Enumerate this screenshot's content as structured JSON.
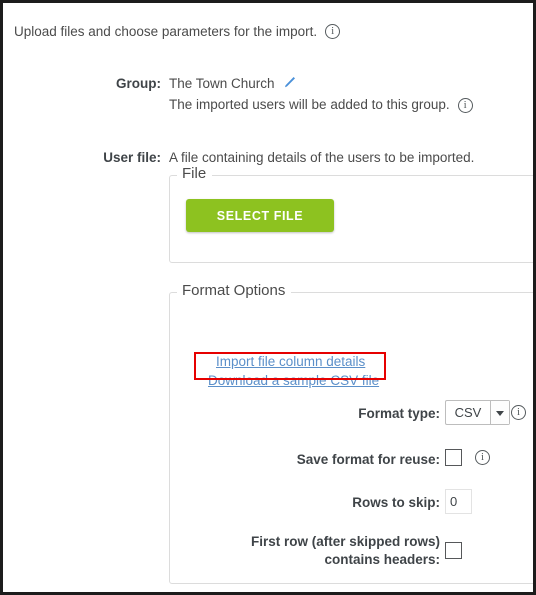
{
  "page": {
    "intro_text": "Upload files and choose parameters for the import."
  },
  "group": {
    "label": "Group:",
    "name": "The Town Church",
    "description": "The imported users will be added to this group.",
    "edit_icon": "pencil-icon",
    "edit_icon_color": "#4a90d9"
  },
  "user_file": {
    "label": "User file:",
    "description": "A file containing details of the users to be imported."
  },
  "file_fieldset": {
    "legend": "File",
    "select_file_button": "SELECT FILE",
    "button_color": "#8dc220"
  },
  "format_options": {
    "legend": "Format Options",
    "links": [
      {
        "label": "Import file column details",
        "color": "#5b8fc9"
      },
      {
        "label": "Download a sample CSV file",
        "color": "#5b8fc9"
      }
    ],
    "highlight_color": "#e60000",
    "format_type": {
      "label": "Format type:",
      "value": "CSV",
      "options": [
        "CSV"
      ]
    },
    "save_format": {
      "label": "Save format for reuse:",
      "checked": false
    },
    "rows_to_skip": {
      "label": "Rows to skip:",
      "value": "0"
    },
    "first_row_headers": {
      "label": "First row (after skipped rows) contains headers:",
      "label_line1": "First row (after skipped rows)",
      "label_line2": "contains headers:",
      "checked": false
    }
  },
  "icons": {
    "info": "info-icon"
  }
}
